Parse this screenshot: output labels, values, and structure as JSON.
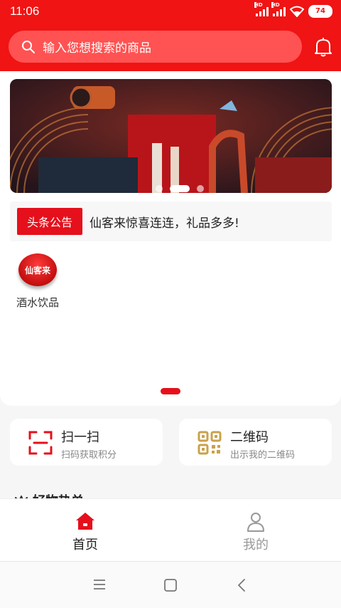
{
  "status_bar": {
    "time": "11:06",
    "hd": "HD",
    "battery": "74"
  },
  "search": {
    "placeholder": "输入您想搜索的商品"
  },
  "notice": {
    "tag": "头条公告",
    "message": "仙客来惊喜连连，礼品多多!"
  },
  "categories": [
    {
      "label": "酒水饮品",
      "logo_text": "仙客来"
    }
  ],
  "quick_actions": [
    {
      "title": "扫一扫",
      "subtitle": "扫码获取积分",
      "icon": "scan-icon"
    },
    {
      "title": "二维码",
      "subtitle": "出示我的二维码",
      "icon": "qr-code-icon"
    }
  ],
  "section": {
    "title": "好物热单"
  },
  "tabbar": {
    "tabs": [
      {
        "label": "首页",
        "icon": "home-icon",
        "active": true
      },
      {
        "label": "我的",
        "icon": "user-icon",
        "active": false
      }
    ]
  },
  "banner": {
    "slide_count": 3,
    "active_index": 0
  },
  "colors": {
    "brand": "#f01414",
    "tag": "#e5101b",
    "qr": "#c9a24a"
  }
}
